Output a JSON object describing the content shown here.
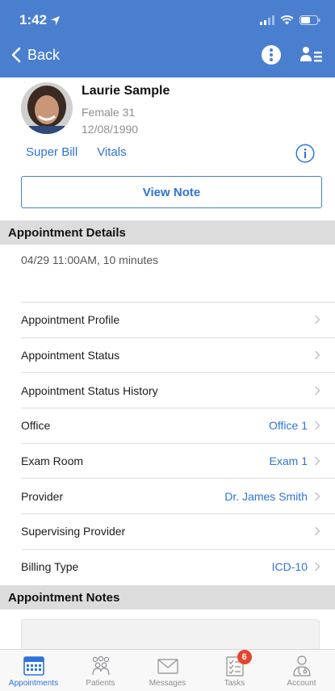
{
  "status_bar": {
    "time": "1:42"
  },
  "nav": {
    "back_label": "Back"
  },
  "patient": {
    "name": "Laurie Sample",
    "gender_age": "Female 31",
    "dob": "12/08/1990",
    "links": [
      "Super Bill",
      "Vitals"
    ],
    "view_note_label": "View Note"
  },
  "appointment_details": {
    "header": "Appointment Details",
    "time": "04/29 11:00AM, 10 minutes",
    "rows": [
      {
        "label": "Appointment Profile",
        "value": ""
      },
      {
        "label": "Appointment Status",
        "value": ""
      },
      {
        "label": "Appointment Status History",
        "value": ""
      },
      {
        "label": "Office",
        "value": "Office 1"
      },
      {
        "label": "Exam Room",
        "value": "Exam 1"
      },
      {
        "label": "Provider",
        "value": "Dr. James Smith"
      },
      {
        "label": "Supervising Provider",
        "value": ""
      },
      {
        "label": "Billing Type",
        "value": "ICD-10"
      }
    ]
  },
  "appointment_notes": {
    "header": "Appointment Notes"
  },
  "tabbar": {
    "tabs": [
      {
        "label": "Appointments",
        "icon": "calendar-icon",
        "active": true
      },
      {
        "label": "Patients",
        "icon": "patients-icon"
      },
      {
        "label": "Messages",
        "icon": "envelope-icon"
      },
      {
        "label": "Tasks",
        "icon": "tasks-icon",
        "badge": "6"
      },
      {
        "label": "Account",
        "icon": "doctor-icon"
      }
    ]
  },
  "colors": {
    "nav": "#4a7fd0",
    "link": "#2f73d8",
    "section": "#dcdcdc",
    "badge": "#e5452f"
  }
}
